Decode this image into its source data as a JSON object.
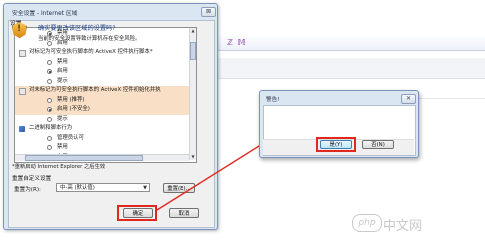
{
  "background": {
    "toolbar_icons": "ℤ 𝕄"
  },
  "security_dialog": {
    "title": "安全设置 - Internet 区域",
    "close_symbol": "⊠",
    "group_label": "设置",
    "rows": [
      {
        "type": "radio",
        "label": "禁用",
        "checked": true
      },
      {
        "type": "radio",
        "label": "启用",
        "checked": false
      },
      {
        "type": "heading",
        "label": "对标记为可安全执行脚本的 ActiveX 控件执行脚本*",
        "icon": "doc-icon"
      },
      {
        "type": "radio",
        "label": "禁用",
        "checked": false
      },
      {
        "type": "radio",
        "label": "启用",
        "checked": true
      },
      {
        "type": "radio",
        "label": "提示",
        "checked": false
      },
      {
        "type": "heading",
        "label": "对未标记为可安全执行脚本的 ActiveX 控件初始化并执",
        "icon": "doc-icon",
        "highlight": true
      },
      {
        "type": "radio",
        "label": "禁用 (推荐)",
        "checked": false,
        "highlight": true
      },
      {
        "type": "radio",
        "label": "启用 (不安全)",
        "checked": true,
        "highlight": true
      },
      {
        "type": "radio",
        "label": "提示",
        "checked": false
      },
      {
        "type": "heading",
        "label": "二进制和脚本行为",
        "icon": "shield-icon"
      },
      {
        "type": "radio",
        "label": "管理员认可",
        "checked": false
      },
      {
        "type": "radio",
        "label": "禁用",
        "checked": false
      },
      {
        "type": "radio",
        "label": "启用",
        "checked": true
      }
    ],
    "note": "*重新启动 Internet Explorer 之后生效",
    "reset_group": "重置自定义设置",
    "reset_label": "重置为(R):",
    "reset_select_value": "中-高 (默认值)",
    "reset_button": "重置(E)...",
    "ok_button": "确定",
    "cancel_button": "取消"
  },
  "warning_dialog": {
    "title": "警告!",
    "close_symbol": "✕",
    "heading": "确实要更改该区域的设置吗?",
    "message": "当前的安全设置导致计算机存在安全风险。",
    "yes_button": "是(Y)",
    "no_button": "否(N)"
  },
  "watermark": {
    "logo": "php",
    "text": "中文网"
  },
  "colors": {
    "annotation_red": "#e0281e",
    "highlight_row": "#f9dfc6"
  }
}
